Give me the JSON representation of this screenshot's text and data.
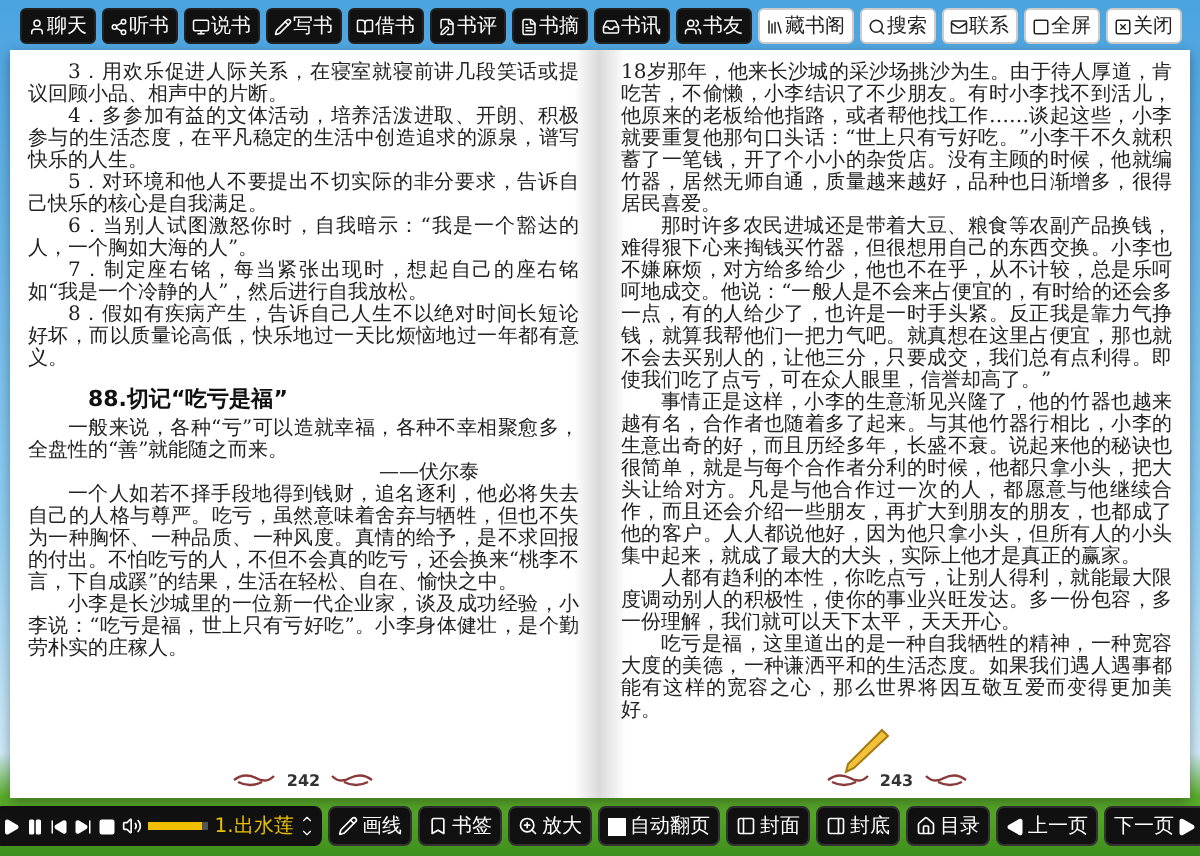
{
  "top_toolbar": [
    {
      "kind": "dark",
      "label": "聊天"
    },
    {
      "kind": "dark",
      "label": "听书"
    },
    {
      "kind": "dark",
      "label": "说书"
    },
    {
      "kind": "dark",
      "label": "写书"
    },
    {
      "kind": "dark",
      "label": "借书"
    },
    {
      "kind": "dark",
      "label": "书评"
    },
    {
      "kind": "dark",
      "label": "书摘"
    },
    {
      "kind": "dark",
      "label": "书讯"
    },
    {
      "kind": "dark",
      "label": "书友"
    },
    {
      "kind": "light",
      "label": "藏书阁"
    },
    {
      "kind": "light",
      "label": "搜索"
    },
    {
      "kind": "light",
      "label": "联系"
    },
    {
      "kind": "light",
      "label": "全屏"
    },
    {
      "kind": "light",
      "label": "关闭"
    }
  ],
  "left_page": {
    "page_number": "242",
    "blocks": [
      {
        "kind": "para",
        "text": "3．用欢乐促进人际关系，在寝室就寝前讲几段笑话或提议回顾小品、相声中的片断。"
      },
      {
        "kind": "para",
        "text": "4．多参加有益的文体活动，培养活泼进取、开朗、积极参与的生活态度，在平凡稳定的生活中创造追求的源泉，谱写快乐的人生。"
      },
      {
        "kind": "para",
        "text": "5．对环境和他人不要提出不切实际的非分要求，告诉自己快乐的核心是自我满足。"
      },
      {
        "kind": "para",
        "text": "6．当别人试图激怒你时，自我暗示：“我是一个豁达的人，一个胸如大海的人”。"
      },
      {
        "kind": "para",
        "text": "7．制定座右铭，每当紧张出现时，想起自己的座右铭如“我是一个冷静的人”，然后进行自我放松。"
      },
      {
        "kind": "para",
        "text": "8．假如有疾病产生，告诉自己人生不以绝对时间长短论好坏，而以质量论高低，快乐地过一天比烦恼地过一年都有意义。"
      },
      {
        "kind": "heading",
        "text": "88.切记“吃亏是福”"
      },
      {
        "kind": "para",
        "text": "一般来说，各种“亏”可以造就幸福，各种不幸相聚愈多，全盘性的“善”就能随之而来。"
      },
      {
        "kind": "attribution",
        "text": "——伏尔泰"
      },
      {
        "kind": "para",
        "text": "一个人如若不择手段地得到钱财，追名逐利，他必将失去自己的人格与尊严。吃亏，虽然意味着舍弃与牺牲，但也不失为一种胸怀、一种品质、一种风度。真情的给予，是不求回报的付出。不怕吃亏的人，不但不会真的吃亏，还会换来“桃李不言，下自成蹊”的结果，生活在轻松、自在、愉快之中。"
      },
      {
        "kind": "para",
        "text": "小李是长沙城里的一位新一代企业家，谈及成功经验，小李说：“吃亏是福，世上只有亏好吃”。小李身体健壮，是个勤劳朴实的庄稼人。"
      }
    ]
  },
  "right_page": {
    "page_number": "243",
    "blocks": [
      {
        "kind": "first",
        "text": "18岁那年，他来长沙城的采沙场挑沙为生。由于待人厚道，肯吃苦，不偷懒，小李结识了不少朋友。有时小李找不到活儿，他原来的老板给他指路，或者帮他找工作……谈起这些，小李就要重复他那句口头话：“世上只有亏好吃。”小李干不久就积蓄了一笔钱，开了个小小的杂货店。没有主顾的时候，他就编竹器，居然无师自通，质量越来越好，品种也日渐增多，很得居民喜爱。"
      },
      {
        "kind": "para",
        "text": "那时许多农民进城还是带着大豆、粮食等农副产品换钱，难得狠下心来掏钱买竹器，但很想用自己的东西交换。小李也不嫌麻烦，对方给多给少，他也不在乎，从不计较，总是乐呵呵地成交。他说：“一般人是不会来占便宜的，有时给的还会多一点，有的人给少了，也许是一时手头紧。反正我是靠力气挣钱，就算我帮他们一把力气吧。就真想在这里占便宜，那也就不会去买别人的，让他三分，只要成交，我们总有点利得。即使我们吃了点亏，可在众人眼里，信誉却高了。”"
      },
      {
        "kind": "para",
        "text": "事情正是这样，小李的生意渐见兴隆了，他的竹器也越来越有名，合作者也随着多了起来。与其他竹器行相比，小李的生意出奇的好，而且历经多年，长盛不衰。说起来他的秘诀也很简单，就是与每个合作者分利的时候，他都只拿小头，把大头让给对方。凡是与他合作过一次的人，都愿意与他继续合作，而且还会介绍一些朋友，再扩大到朋友的朋友，也都成了他的客户。人人都说他好，因为他只拿小头，但所有人的小头集中起来，就成了最大的大头，实际上他才是真正的赢家。"
      },
      {
        "kind": "para",
        "text": "人都有趋利的本性，你吃点亏，让别人得利，就能最大限度调动别人的积极性，使你的事业兴旺发达。多一份包容，多一份理解，我们就可以天下太平，天天开心。"
      },
      {
        "kind": "para",
        "text": "吃亏是福，这里道出的是一种自我牺牲的精神，一种宽容大度的美德，一种谦洒平和的生活态度。如果我们遇人遇事都能有这样的宽容之心，那么世界将因互敬互爱而变得更加美好。"
      }
    ]
  },
  "player": {
    "track": "1.出水莲",
    "volume": {
      "level": 0.9
    }
  },
  "bottom_bar": [
    {
      "kind": "button",
      "label": "画线"
    },
    {
      "kind": "button",
      "label": "书签"
    },
    {
      "kind": "button",
      "label": "放大"
    },
    {
      "kind": "checkbox",
      "label": "自动翻页",
      "checked": false
    },
    {
      "kind": "button",
      "label": "封面"
    },
    {
      "kind": "button",
      "label": "封底"
    },
    {
      "kind": "button",
      "label": "目录"
    },
    {
      "kind": "prev",
      "label": "上一页"
    },
    {
      "kind": "next",
      "label": "下一页"
    }
  ]
}
